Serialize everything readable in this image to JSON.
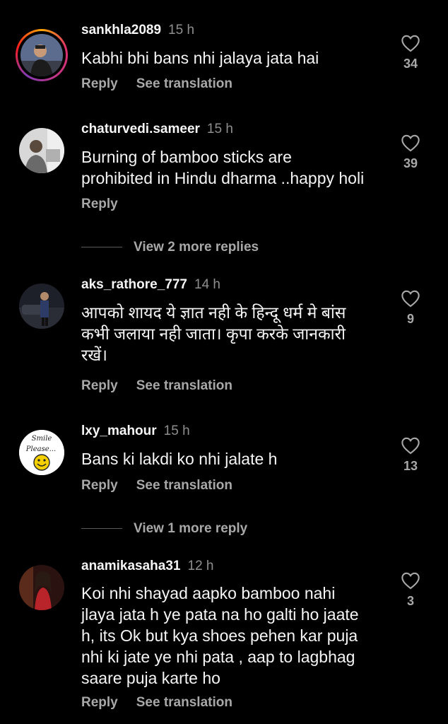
{
  "comments": [
    {
      "username": "sankhla2089",
      "time": "15 h",
      "text": "Kabhi bhi bans nhi jalaya jata hai",
      "reply": "Reply",
      "translate": "See translation",
      "likes": "34"
    },
    {
      "username": "chaturvedi.sameer",
      "time": "15 h",
      "text": "Burning of bamboo sticks are\nprohibited in Hindu dharma ..happy holi",
      "reply": "Reply",
      "likes": "39"
    },
    {
      "username": "aks_rathore_777",
      "time": "14 h",
      "text": "आपको शायद ये ज्ञात नही के हिन्दू धर्म मे बांस\nकभी जलाया नही जाता। कृपा करके जानकारी\nरखें।",
      "reply": "Reply",
      "translate": "See translation",
      "likes": "9"
    },
    {
      "username": "lxy_mahour",
      "time": "15 h",
      "text": "Bans ki lakdi ko nhi jalate h",
      "reply": "Reply",
      "translate": "See translation",
      "likes": "13",
      "avatar_text_1": "Smile",
      "avatar_text_2": "Please..."
    },
    {
      "username": "anamikasaha31",
      "time": "12 h",
      "text": "Koi nhi shayad aapko bamboo nahi\njlaya jata h ye pata na ho galti ho jaate\nh, its Ok but kya shoes pehen kar puja\nnhi ki jate ye nhi pata , aap to lagbhag\nsaare puja karte ho",
      "reply": "Reply",
      "translate": "See translation",
      "likes": "3"
    }
  ],
  "view_more": [
    "View 2 more replies",
    "View 1 more reply"
  ],
  "colors": {
    "background": "#000000",
    "muted": "#a8a8a8",
    "username": "#f5f5f5"
  }
}
